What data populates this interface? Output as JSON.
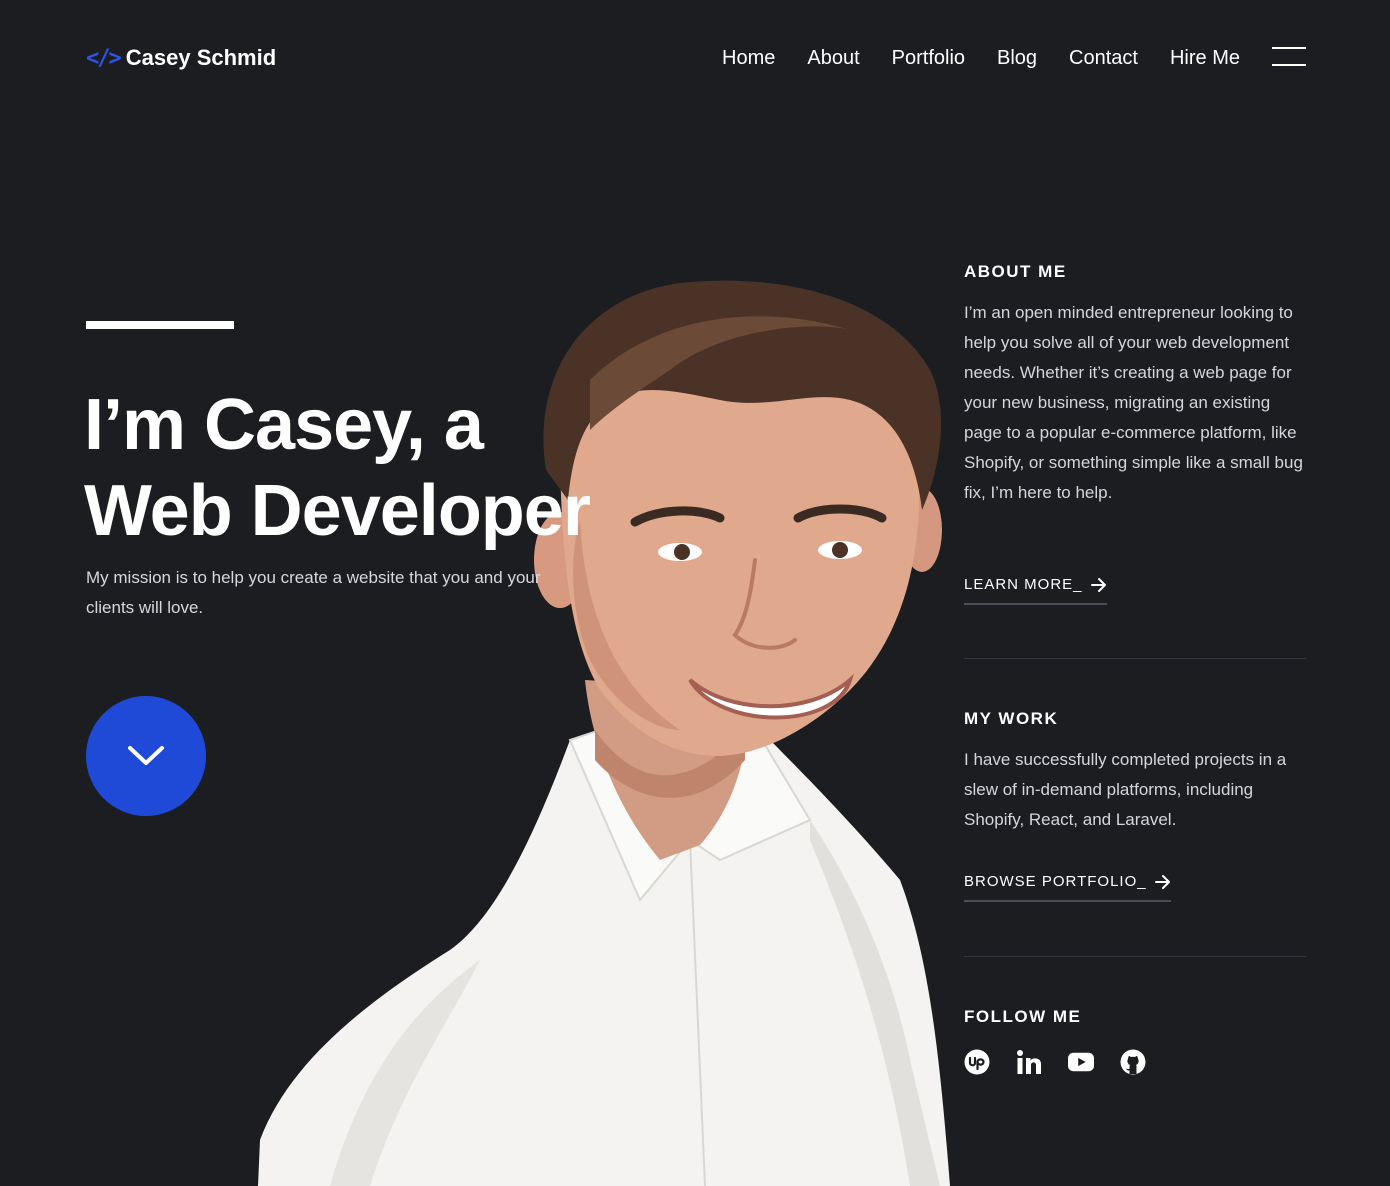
{
  "header": {
    "logo_mark": "</>",
    "logo_text": "Casey Schmid",
    "nav": [
      "Home",
      "About",
      "Portfolio",
      "Blog",
      "Contact",
      "Hire Me"
    ]
  },
  "hero": {
    "title_line1": "I’m Casey, a",
    "title_line2": "Web Developer",
    "subtitle": "My mission is to help you create a website that you and your clients will love."
  },
  "about": {
    "heading": "ABOUT ME",
    "text": "I’m an open minded entrepreneur looking to help you solve all of your web development needs. Whether it’s creating a web page for your new business, migrating an existing page to a popular e-commerce platform, like Shopify, or something simple like a small bug fix, I’m here to help.",
    "cta": "LEARN MORE_"
  },
  "work": {
    "heading": "MY WORK",
    "text": "I have successfully completed projects in a slew of in-demand platforms, including Shopify, React, and Laravel.",
    "cta": "BROWSE PORTFOLIO_"
  },
  "follow": {
    "heading": "FOLLOW ME",
    "icons": [
      "upwork-icon",
      "linkedin-icon",
      "youtube-icon",
      "github-icon"
    ]
  },
  "colors": {
    "background": "#1c1d21",
    "accent": "#1f4ad8",
    "text": "#ffffff",
    "muted_text": "#d4d6dc"
  }
}
